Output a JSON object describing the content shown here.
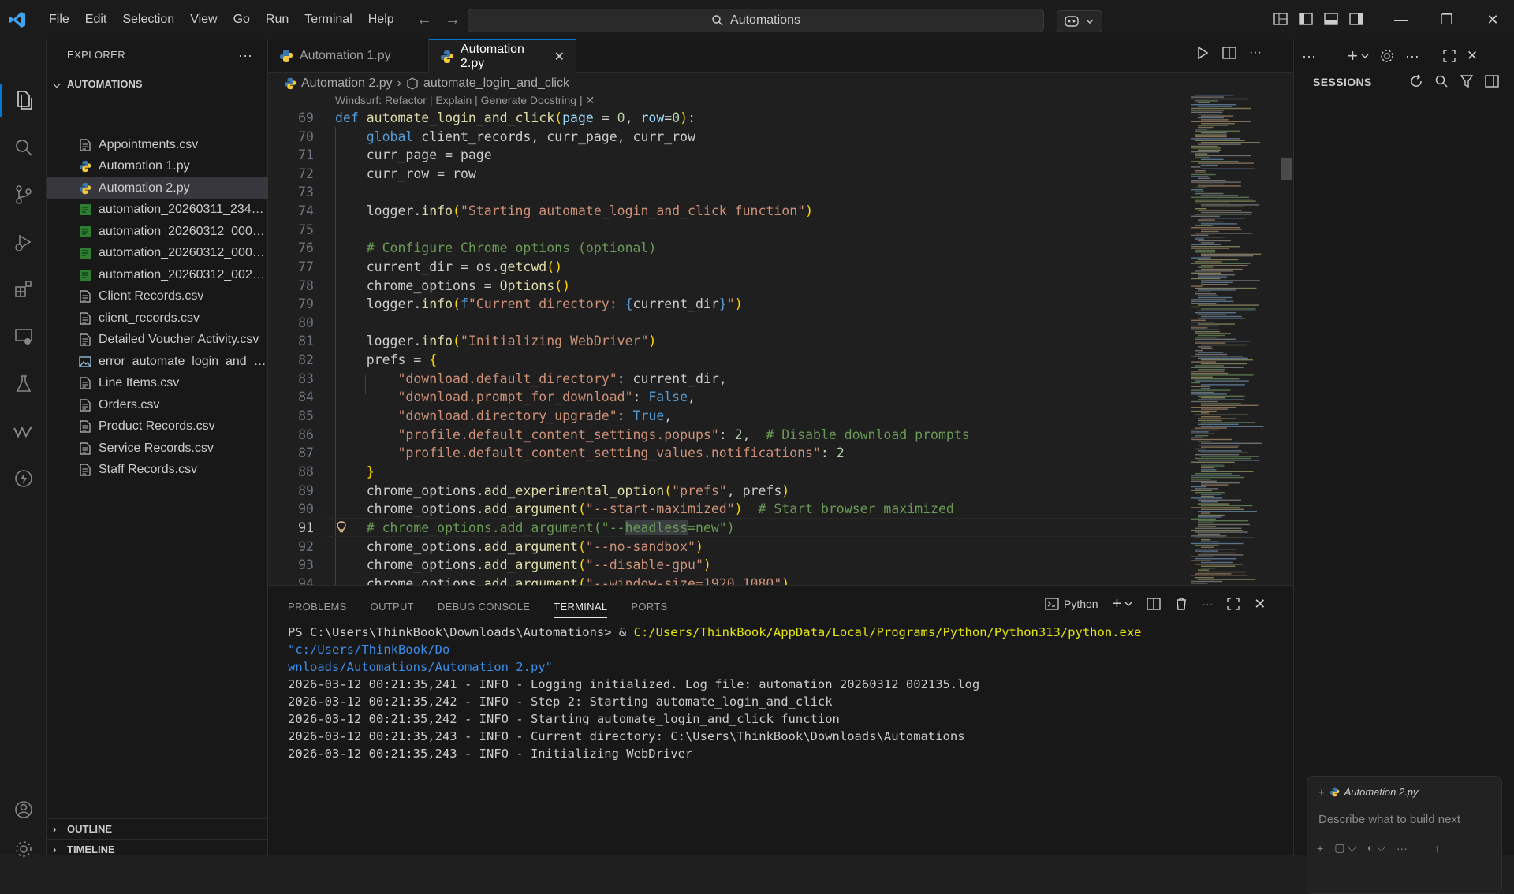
{
  "menu": [
    "File",
    "Edit",
    "Selection",
    "View",
    "Go",
    "Run",
    "Terminal",
    "Help"
  ],
  "command_center": {
    "label": "Automations"
  },
  "window_controls": {
    "minimize": "—",
    "restore": "❐",
    "close": "✕"
  },
  "explorer": {
    "title": "EXPLORER",
    "section": "AUTOMATIONS",
    "files": [
      {
        "name": "Appointments.csv",
        "type": "csv"
      },
      {
        "name": "Automation 1.py",
        "type": "py"
      },
      {
        "name": "Automation 2.py",
        "type": "py",
        "selected": true
      },
      {
        "name": "automation_20260311_2346...",
        "type": "log"
      },
      {
        "name": "automation_20260312_0005...",
        "type": "log"
      },
      {
        "name": "automation_20260312_0005...",
        "type": "log"
      },
      {
        "name": "automation_20260312_0021...",
        "type": "log"
      },
      {
        "name": "Client Records.csv",
        "type": "csv"
      },
      {
        "name": "client_records.csv",
        "type": "csv"
      },
      {
        "name": "Detailed Voucher Activity.csv",
        "type": "csv"
      },
      {
        "name": "error_automate_login_and_c...",
        "type": "img"
      },
      {
        "name": "Line Items.csv",
        "type": "csv"
      },
      {
        "name": "Orders.csv",
        "type": "csv"
      },
      {
        "name": "Product Records.csv",
        "type": "csv"
      },
      {
        "name": "Service Records.csv",
        "type": "csv"
      },
      {
        "name": "Staff Records.csv",
        "type": "csv"
      }
    ],
    "outline": "OUTLINE",
    "timeline": "TIMELINE"
  },
  "tabs": [
    {
      "label": "Automation 1.py",
      "active": false
    },
    {
      "label": "Automation 2.py",
      "active": true,
      "close": "✕"
    }
  ],
  "breadcrumb": {
    "file": "Automation 2.py",
    "symbol": "automate_login_and_click"
  },
  "codelens": "Windsurf: Refactor | Explain | Generate Docstring | ✕",
  "code": {
    "line_numbers": [
      "69",
      "70",
      "71",
      "72",
      "73",
      "74",
      "75",
      "76",
      "77",
      "78",
      "79",
      "80",
      "81",
      "82",
      "83",
      "84",
      "85",
      "86",
      "87",
      "88",
      "89",
      "90",
      "91",
      "92",
      "93",
      "94"
    ],
    "current_line": "91"
  },
  "panel": {
    "tabs": [
      "PROBLEMS",
      "OUTPUT",
      "DEBUG CONSOLE",
      "TERMINAL",
      "PORTS"
    ],
    "active_tab": "TERMINAL",
    "shell": "Python",
    "terminal": {
      "prompt": "PS C:\\Users\\ThinkBook\\Downloads\\Automations> & ",
      "exe": "C:/Users/ThinkBook/AppData/Local/Programs/Python/Python313/python.exe",
      "arg1": " \"c:/Users/ThinkBook/Do",
      "arg2": "wnloads/Automations/Automation 2.py\"",
      "log": [
        "2026-03-12 00:21:35,241 - INFO - Logging initialized. Log file: automation_20260312_002135.log",
        "2026-03-12 00:21:35,242 - INFO - Step 2: Starting automate_login_and_click",
        "2026-03-12 00:21:35,242 - INFO - Starting automate_login_and_click function",
        "2026-03-12 00:21:35,243 - INFO - Current directory: C:\\Users\\ThinkBook\\Downloads\\Automations",
        "2026-03-12 00:21:35,243 - INFO - Initializing WebDriver"
      ]
    }
  },
  "sessions": {
    "title": "SESSIONS",
    "chat_file": "Automation 2.py",
    "chat_placeholder": "Describe what to build next"
  },
  "colors": {
    "accent": "#0078d4",
    "keyword": "#569cd6",
    "function": "#dcdcaa",
    "string": "#ce9178",
    "comment": "#6a9955"
  }
}
